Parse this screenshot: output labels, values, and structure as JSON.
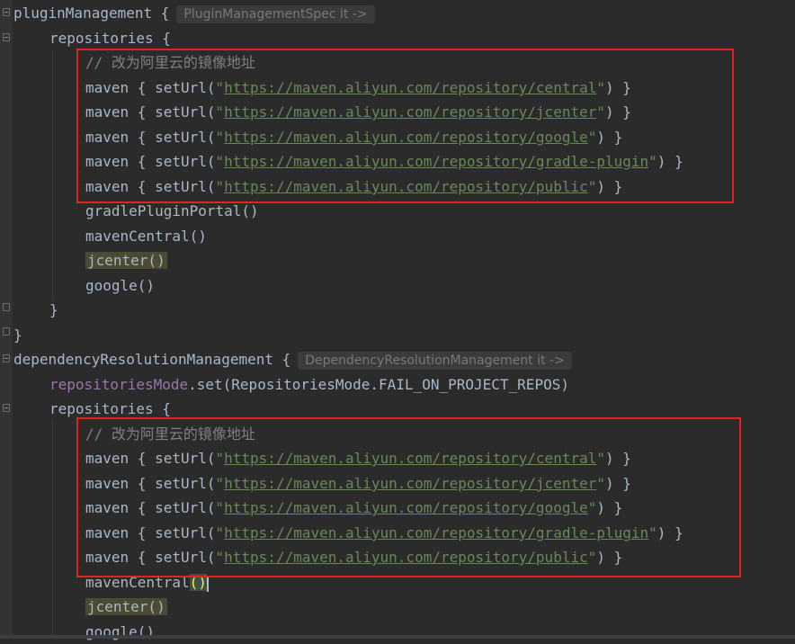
{
  "block1": {
    "name": "pluginManagement",
    "hint": "PluginManagementSpec it ->",
    "repos_label": "repositories",
    "comment": "// 改为阿里云的镜像地址",
    "mirrors": [
      "https://maven.aliyun.com/repository/central",
      "https://maven.aliyun.com/repository/jcenter",
      "https://maven.aliyun.com/repository/google",
      "https://maven.aliyun.com/repository/gradle-plugin",
      "https://maven.aliyun.com/repository/public"
    ],
    "calls": [
      "gradlePluginPortal()",
      "mavenCentral()",
      "jcenter()",
      "google()"
    ]
  },
  "block2": {
    "name": "dependencyResolutionManagement",
    "hint": "DependencyResolutionManagement it ->",
    "mode_prop": "repositoriesMode",
    "mode_rest": ".set(RepositoriesMode.FAIL_ON_PROJECT_REPOS)",
    "repos_label": "repositories",
    "comment": "// 改为阿里云的镜像地址",
    "mirrors": [
      "https://maven.aliyun.com/repository/central",
      "https://maven.aliyun.com/repository/jcenter",
      "https://maven.aliyun.com/repository/google",
      "https://maven.aliyun.com/repository/gradle-plugin",
      "https://maven.aliyun.com/repository/public"
    ],
    "calls": [
      "mavenCentral",
      "jcenter()",
      "google()"
    ]
  },
  "tokens": {
    "maven_open": "maven { setUrl(",
    "quote": "\"",
    "close": ") }",
    "brace_open": " {",
    "brace_close": "}",
    "paren": "()"
  }
}
